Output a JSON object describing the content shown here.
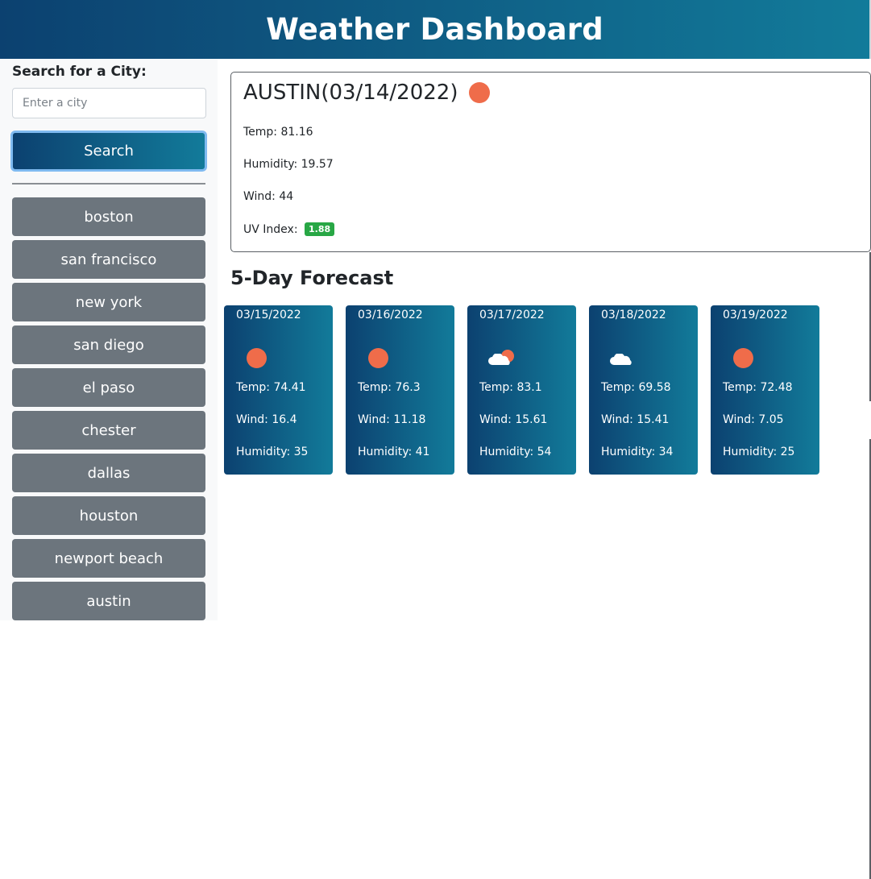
{
  "header": {
    "title": "Weather Dashboard"
  },
  "sidebar": {
    "search_label": "Search for a City:",
    "input_placeholder": "Enter a city",
    "input_value": "",
    "search_button": "Search",
    "history": [
      "boston",
      "san francisco",
      "new york",
      "san diego",
      "el paso",
      "chester",
      "dallas",
      "houston",
      "newport beach",
      "austin"
    ]
  },
  "current": {
    "title": "AUSTIN(03/14/2022)",
    "icon": "sun-icon",
    "temp": "Temp: 81.16",
    "humidity": "Humidity: 19.57",
    "wind": "Wind: 44",
    "uv_label": "UV Index:",
    "uv_value": "1.88",
    "uv_color": "#28a745"
  },
  "forecast": {
    "title": "5-Day Forecast",
    "days": [
      {
        "date": "03/15/2022",
        "icon": "sun-icon",
        "temp": "Temp: 74.41",
        "wind": "Wind: 16.4",
        "humidity": "Humidity: 35"
      },
      {
        "date": "03/16/2022",
        "icon": "sun-icon",
        "temp": "Temp: 76.3",
        "wind": "Wind: 11.18",
        "humidity": "Humidity: 41"
      },
      {
        "date": "03/17/2022",
        "icon": "partly-cloudy-icon",
        "temp": "Temp: 83.1",
        "wind": "Wind: 15.61",
        "humidity": "Humidity: 54"
      },
      {
        "date": "03/18/2022",
        "icon": "cloud-icon",
        "temp": "Temp: 69.58",
        "wind": "Wind: 15.41",
        "humidity": "Humidity: 34"
      },
      {
        "date": "03/19/2022",
        "icon": "sun-icon",
        "temp": "Temp: 72.48",
        "wind": "Wind: 7.05",
        "humidity": "Humidity: 25"
      }
    ]
  },
  "colors": {
    "accent_gradient_start": "#0c4170",
    "accent_gradient_end": "#127b9a",
    "history_button": "#6c757d",
    "sun": "#ef6c4a"
  }
}
